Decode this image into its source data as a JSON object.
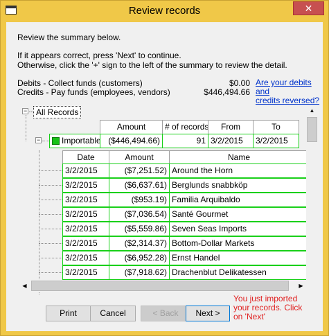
{
  "window": {
    "title": "Review records",
    "close_glyph": "✕"
  },
  "intro": {
    "line1": "Review the summary below.",
    "line2": "If it appears correct, press 'Next' to continue.",
    "line3": "Otherwise, click the '+' sign to the left of the summary to review the detail."
  },
  "summary": {
    "debits_label": "Debits  - Collect funds (customers)",
    "debits_amount": "$0.00",
    "credits_label": "Credits - Pay funds (employees, vendors)",
    "credits_amount": "$446,494.66",
    "reversed_link_line1": "Are your debits and",
    "reversed_link_line2": "credits reversed?"
  },
  "tree": {
    "root_label": "All Records",
    "root_expander": "−",
    "group_expander": "−",
    "group_headers": [
      "Amount",
      "# of records",
      "From",
      "To"
    ],
    "group": {
      "label": "Importable",
      "amount": "($446,494.66)",
      "count": "91",
      "from": "3/2/2015",
      "to": "3/2/2015"
    },
    "detail_headers": [
      "Date",
      "Amount",
      "Name"
    ],
    "rows": [
      {
        "date": "3/2/2015",
        "amount": "($7,251.52)",
        "name": "Around the Horn"
      },
      {
        "date": "3/2/2015",
        "amount": "($6,637.61)",
        "name": "Berglunds snabbköp"
      },
      {
        "date": "3/2/2015",
        "amount": "($953.19)",
        "name": "Familia Arquibaldo"
      },
      {
        "date": "3/2/2015",
        "amount": "($7,036.54)",
        "name": "Santé Gourmet"
      },
      {
        "date": "3/2/2015",
        "amount": "($5,559.86)",
        "name": "Seven Seas Imports"
      },
      {
        "date": "3/2/2015",
        "amount": "($2,314.37)",
        "name": "Bottom-Dollar Markets"
      },
      {
        "date": "3/2/2015",
        "amount": "($6,952.28)",
        "name": "Ernst Handel"
      },
      {
        "date": "3/2/2015",
        "amount": "($7,918.62)",
        "name": "Drachenblut Delikatessen"
      }
    ]
  },
  "buttons": {
    "print": "Print",
    "cancel": "Cancel",
    "back": "< Back",
    "next": "Next >"
  },
  "hint": {
    "line1": "You just imported",
    "line2": "your records. Click",
    "line3": "on 'Next'"
  },
  "colors": {
    "accent": "#0078d7",
    "row_border": "#19d019",
    "hint_text": "#e02020",
    "title_bar": "#f0c848"
  }
}
